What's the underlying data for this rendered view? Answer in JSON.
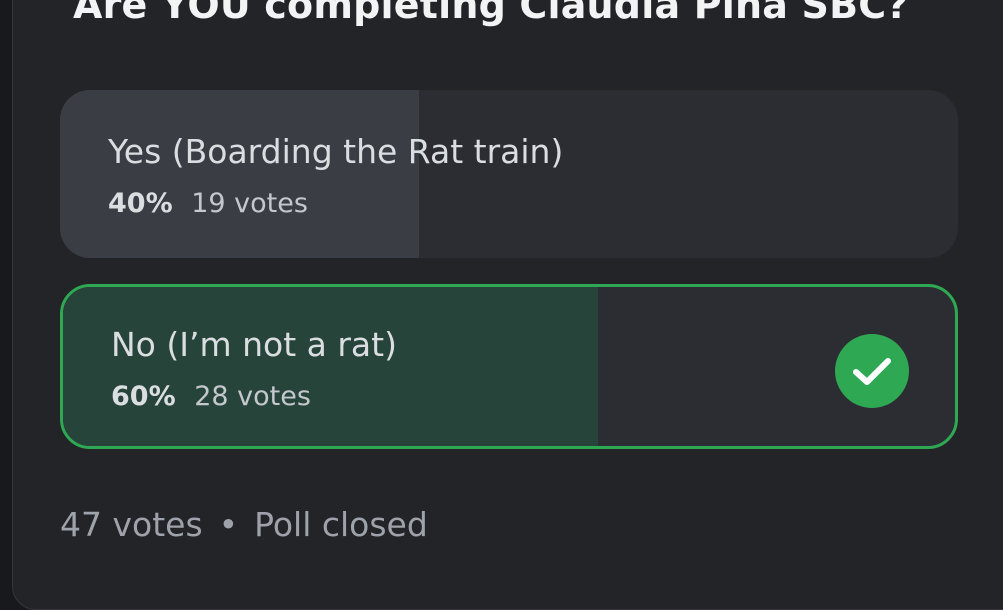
{
  "poll": {
    "question": "Are YOU completing Claudia Pina SBC?",
    "answers": [
      {
        "label": "Yes (Boarding the Rat train)",
        "percent": "40%",
        "votes": "19 votes",
        "share": 0.4,
        "selected": false
      },
      {
        "label": "No (I’m not a rat)",
        "percent": "60%",
        "votes": "28 votes",
        "share": 0.6,
        "selected": true,
        "selected_icon": "check-icon"
      }
    ],
    "footer": {
      "total_votes": "47 votes",
      "separator": "•",
      "status": "Poll closed"
    }
  },
  "colors": {
    "background": "#18191c",
    "card": "#232428",
    "selected_accent": "#2fa853",
    "selected_fill": "#27443b",
    "unselected_fill": "#3b3d45"
  }
}
